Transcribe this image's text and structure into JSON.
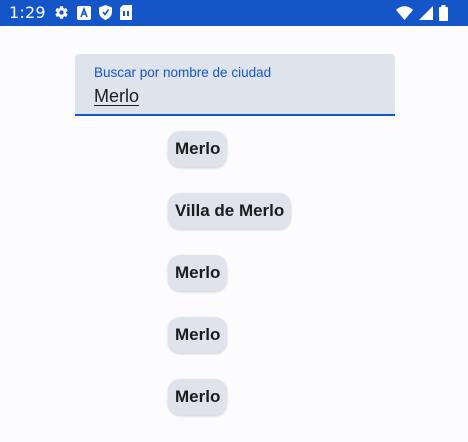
{
  "status_bar": {
    "time": "1:29",
    "background": "#1456c8",
    "left_icons": [
      "gear-icon",
      "a-icon",
      "shield-icon",
      "sim-card-icon"
    ],
    "right_icons": [
      "wifi-icon",
      "signal-icon",
      "battery-icon"
    ]
  },
  "search": {
    "label": "Buscar por nombre de ciudad",
    "value": "Merlo",
    "accent_color": "#1456c8"
  },
  "results": [
    {
      "label": "Merlo"
    },
    {
      "label": "Villa de Merlo"
    },
    {
      "label": "Merlo"
    },
    {
      "label": "Merlo"
    },
    {
      "label": "Merlo"
    }
  ]
}
